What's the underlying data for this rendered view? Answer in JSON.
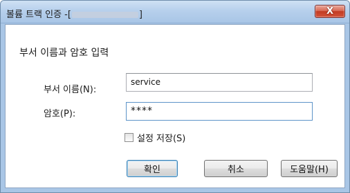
{
  "window": {
    "title_prefix": "볼륨 트랙 인증 -[",
    "title_suffix": "]",
    "close_glyph": "X"
  },
  "form": {
    "heading": "부서 이름과 암호 입력",
    "department_label": "부서 이름(N):",
    "department_value": "service",
    "password_label": "암호(P):",
    "password_value": "****",
    "save_settings_label": "설정 저장(S)",
    "save_settings_checked": false
  },
  "buttons": {
    "ok": "확인",
    "cancel": "취소",
    "help": "도움말(H)"
  },
  "colors": {
    "titlebar": "#b7d0ec",
    "close_button": "#c23b22",
    "default_button_border": "#3c7fb1"
  }
}
